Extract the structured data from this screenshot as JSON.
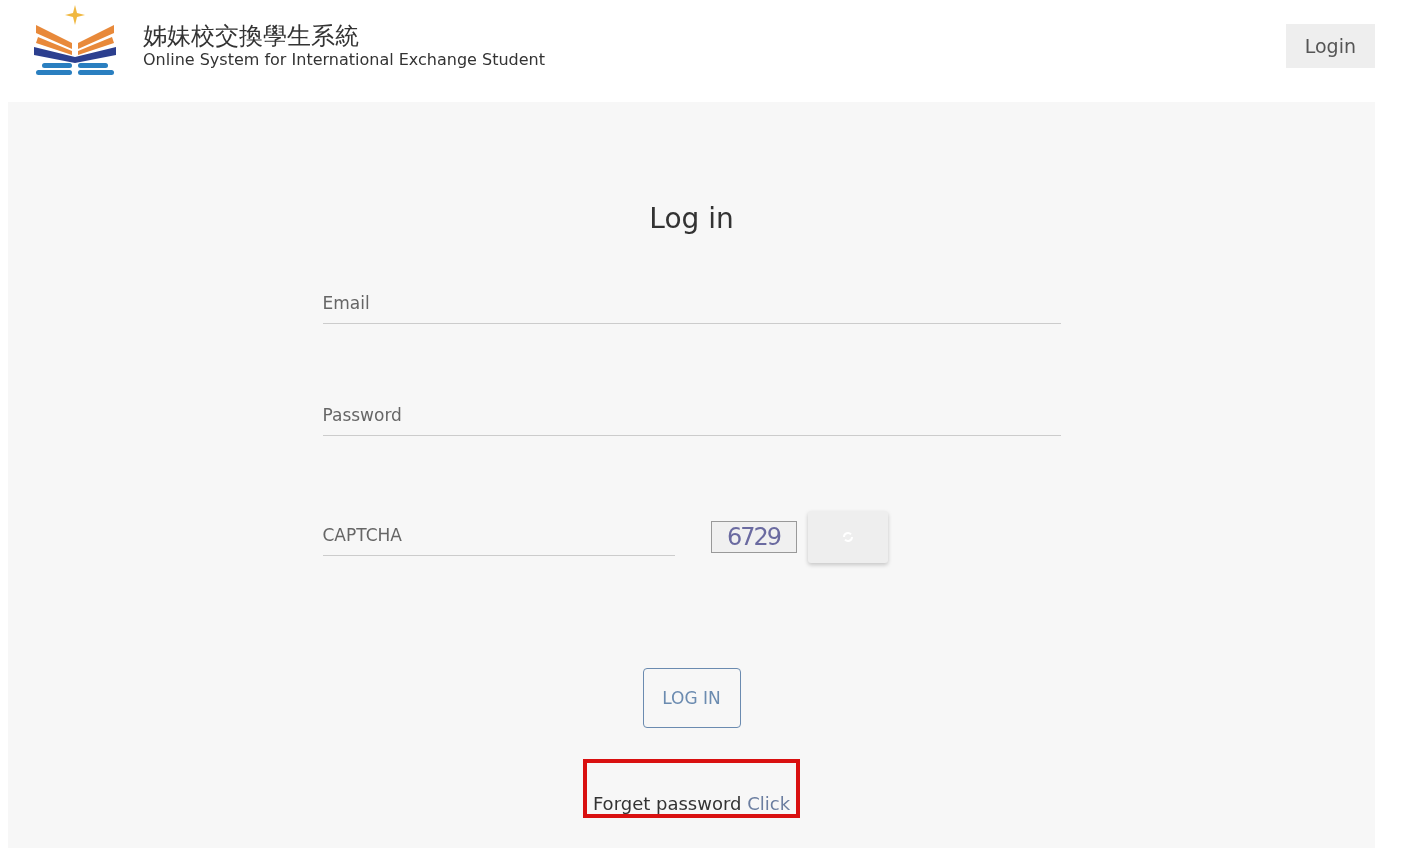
{
  "header": {
    "title": "姊妹校交換學生系統",
    "subtitle": "Online System for International Exchange Student",
    "login_button": "Login"
  },
  "form": {
    "title": "Log in",
    "fields": [
      {
        "kind": "text",
        "placeholder": "Email"
      },
      {
        "kind": "password",
        "placeholder": "Password"
      },
      {
        "kind": "captcha",
        "placeholder": "CAPTCHA",
        "captcha": "6729"
      }
    ],
    "submit": "LOG IN",
    "forgot": {
      "text": "Forget password",
      "link": "Click",
      "highlighted": true
    }
  }
}
